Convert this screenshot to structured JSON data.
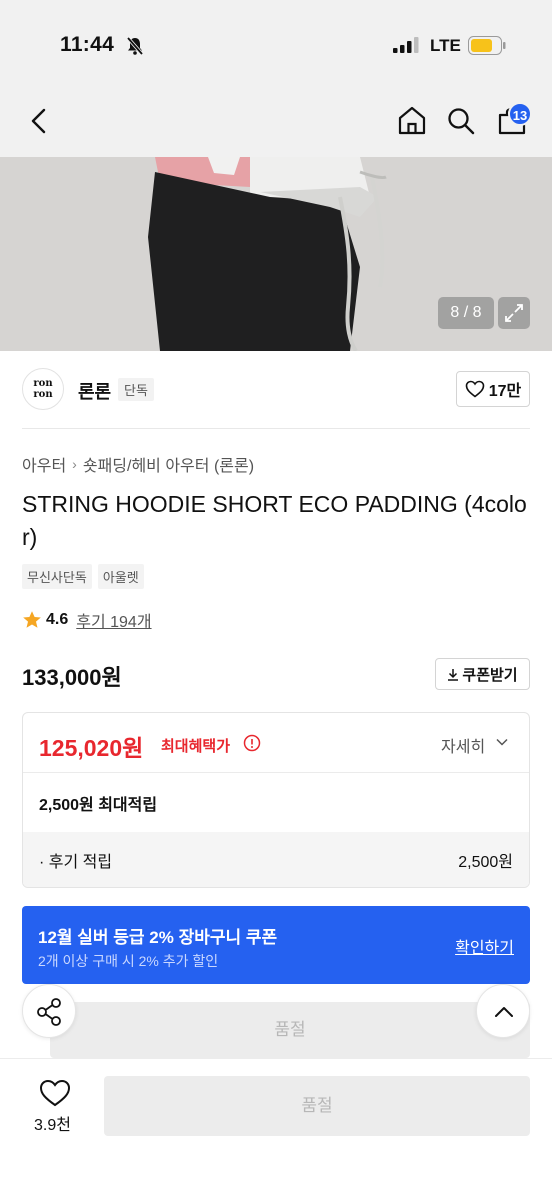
{
  "status_bar": {
    "time": "11:44",
    "network": "LTE"
  },
  "header": {
    "cart_count": "13"
  },
  "gallery": {
    "counter": "8 / 8"
  },
  "brand": {
    "logo_text_1": "ron",
    "logo_text_2": "ron",
    "name": "론론",
    "tag": "단독",
    "like_count": "17만"
  },
  "breadcrumb": {
    "level1": "아우터",
    "level2": "숏패딩/헤비 아우터 (론론)"
  },
  "product": {
    "title": "STRING HOODIE SHORT ECO PADDING (4color)",
    "tags": [
      "무신사단독",
      "아울렛"
    ],
    "rating": "4.6",
    "reviews_label": "후기 194개",
    "price": "133,000원",
    "coupon_label": "쿠폰받기"
  },
  "benefit": {
    "price": "125,020원",
    "label": "최대혜택가",
    "detail_label": "자세히",
    "points_max": "2,500원 최대적립",
    "review_points_label": "· 후기 적립",
    "review_points_amount": "2,500원"
  },
  "promo": {
    "title": "12월 실버 등급 2% 장바구니 쿠폰",
    "subtitle": "2개 이상 구매 시 2% 추가 할인",
    "link": "확인하기"
  },
  "soldout_inline": "품절",
  "bottom": {
    "fav_count": "3.9천",
    "buy_label": "품절"
  },
  "colors": {
    "accent_blue": "#2561f0",
    "benefit_red": "#e8272e",
    "star": "#f5a623"
  }
}
